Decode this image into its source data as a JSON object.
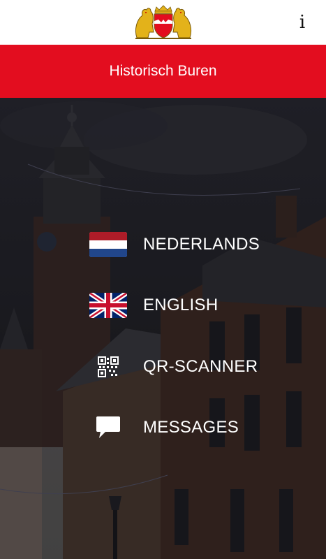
{
  "header": {
    "info_label": "i",
    "crest_icon": "coat-of-arms-logo"
  },
  "titlebar": {
    "title": "Historisch Buren",
    "color": "#e30d1f"
  },
  "menu": {
    "items": [
      {
        "label": "NEDERLANDS",
        "icon": "dutch-flag-icon"
      },
      {
        "label": "ENGLISH",
        "icon": "uk-flag-icon"
      },
      {
        "label": "QR-SCANNER",
        "icon": "qr-code-icon"
      },
      {
        "label": "MESSAGES",
        "icon": "chat-bubble-icon"
      }
    ]
  }
}
